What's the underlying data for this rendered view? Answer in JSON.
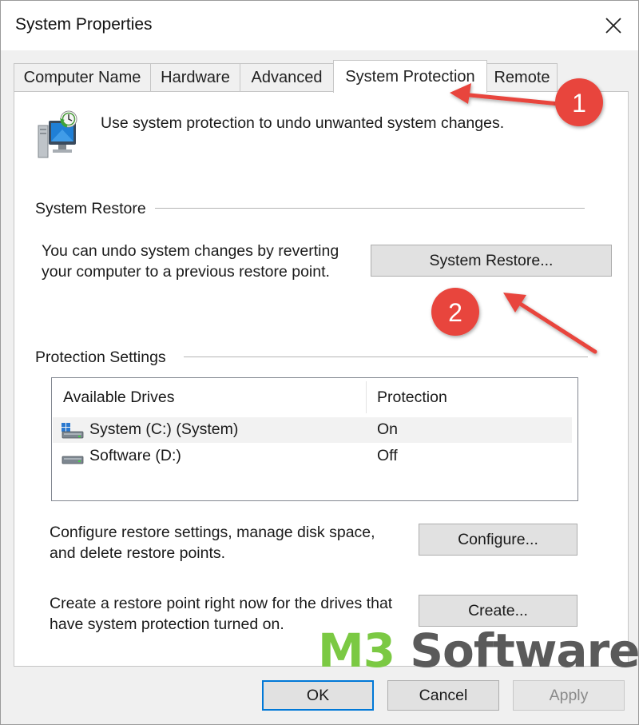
{
  "window": {
    "title": "System Properties"
  },
  "tabs": [
    {
      "label": "Computer Name",
      "active": false
    },
    {
      "label": "Hardware",
      "active": false
    },
    {
      "label": "Advanced",
      "active": false
    },
    {
      "label": "System Protection",
      "active": true
    },
    {
      "label": "Remote",
      "active": false
    }
  ],
  "intro": {
    "text": "Use system protection to undo unwanted system changes."
  },
  "system_restore": {
    "group_label": "System Restore",
    "description_line1": "You can undo system changes by reverting",
    "description_line2": "your computer to a previous restore point.",
    "button_label": "System Restore..."
  },
  "protection_settings": {
    "group_label": "Protection Settings",
    "columns": [
      "Available Drives",
      "Protection"
    ],
    "drives": [
      {
        "name": "System (C:) (System)",
        "protection": "On",
        "icon": "system-drive-icon"
      },
      {
        "name": "Software (D:)",
        "protection": "Off",
        "icon": "drive-icon"
      }
    ],
    "configure_desc_line1": "Configure restore settings, manage disk space,",
    "configure_desc_line2": "and delete restore points.",
    "configure_label": "Configure...",
    "create_desc_line1": "Create a restore point right now for the drives that",
    "create_desc_line2": "have system protection turned on.",
    "create_label": "Create..."
  },
  "footer": {
    "ok_label": "OK",
    "cancel_label": "Cancel",
    "apply_label": "Apply"
  },
  "annotations": {
    "marker1": "1",
    "marker2": "2",
    "marker_color": "#e8453c",
    "arrow_color": "#e8453c"
  },
  "watermark": {
    "part1": "M3",
    "part2": " Software"
  },
  "colors": {
    "accent": "#0078d7",
    "watermark_green": "#7bc943",
    "watermark_gray": "#5a5a5a"
  }
}
